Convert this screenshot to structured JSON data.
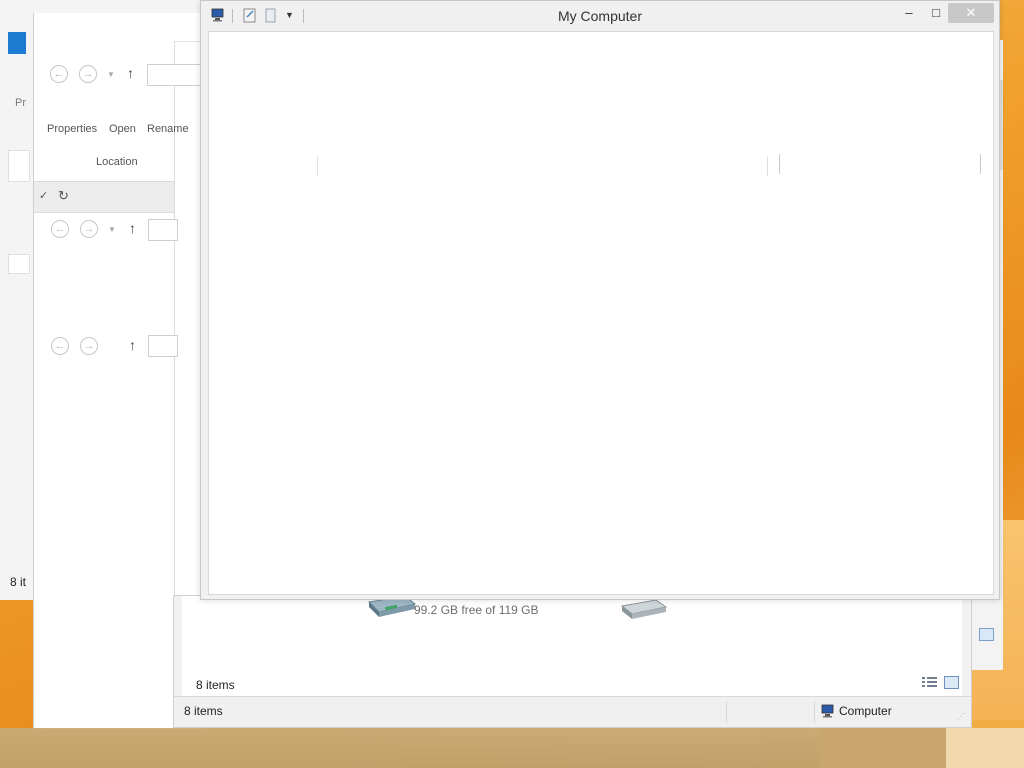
{
  "back_window": {
    "label_fragment": "Pr",
    "status_fragment": "8 it"
  },
  "middle_window": {
    "ribbon": {
      "properties": "Properties",
      "open": "Open",
      "rename": "Rename",
      "group_location": "Location"
    }
  },
  "front_window": {
    "drive_free_text": "99.2 GB free of 119 GB",
    "items_count_inner": "8 items",
    "items_count_status": "8 items",
    "status_location": "Computer"
  },
  "dialog": {
    "title": "My Computer"
  },
  "colors": {
    "accent_blue": "#1e7bd2",
    "desktop_orange": "#f0a12c"
  }
}
